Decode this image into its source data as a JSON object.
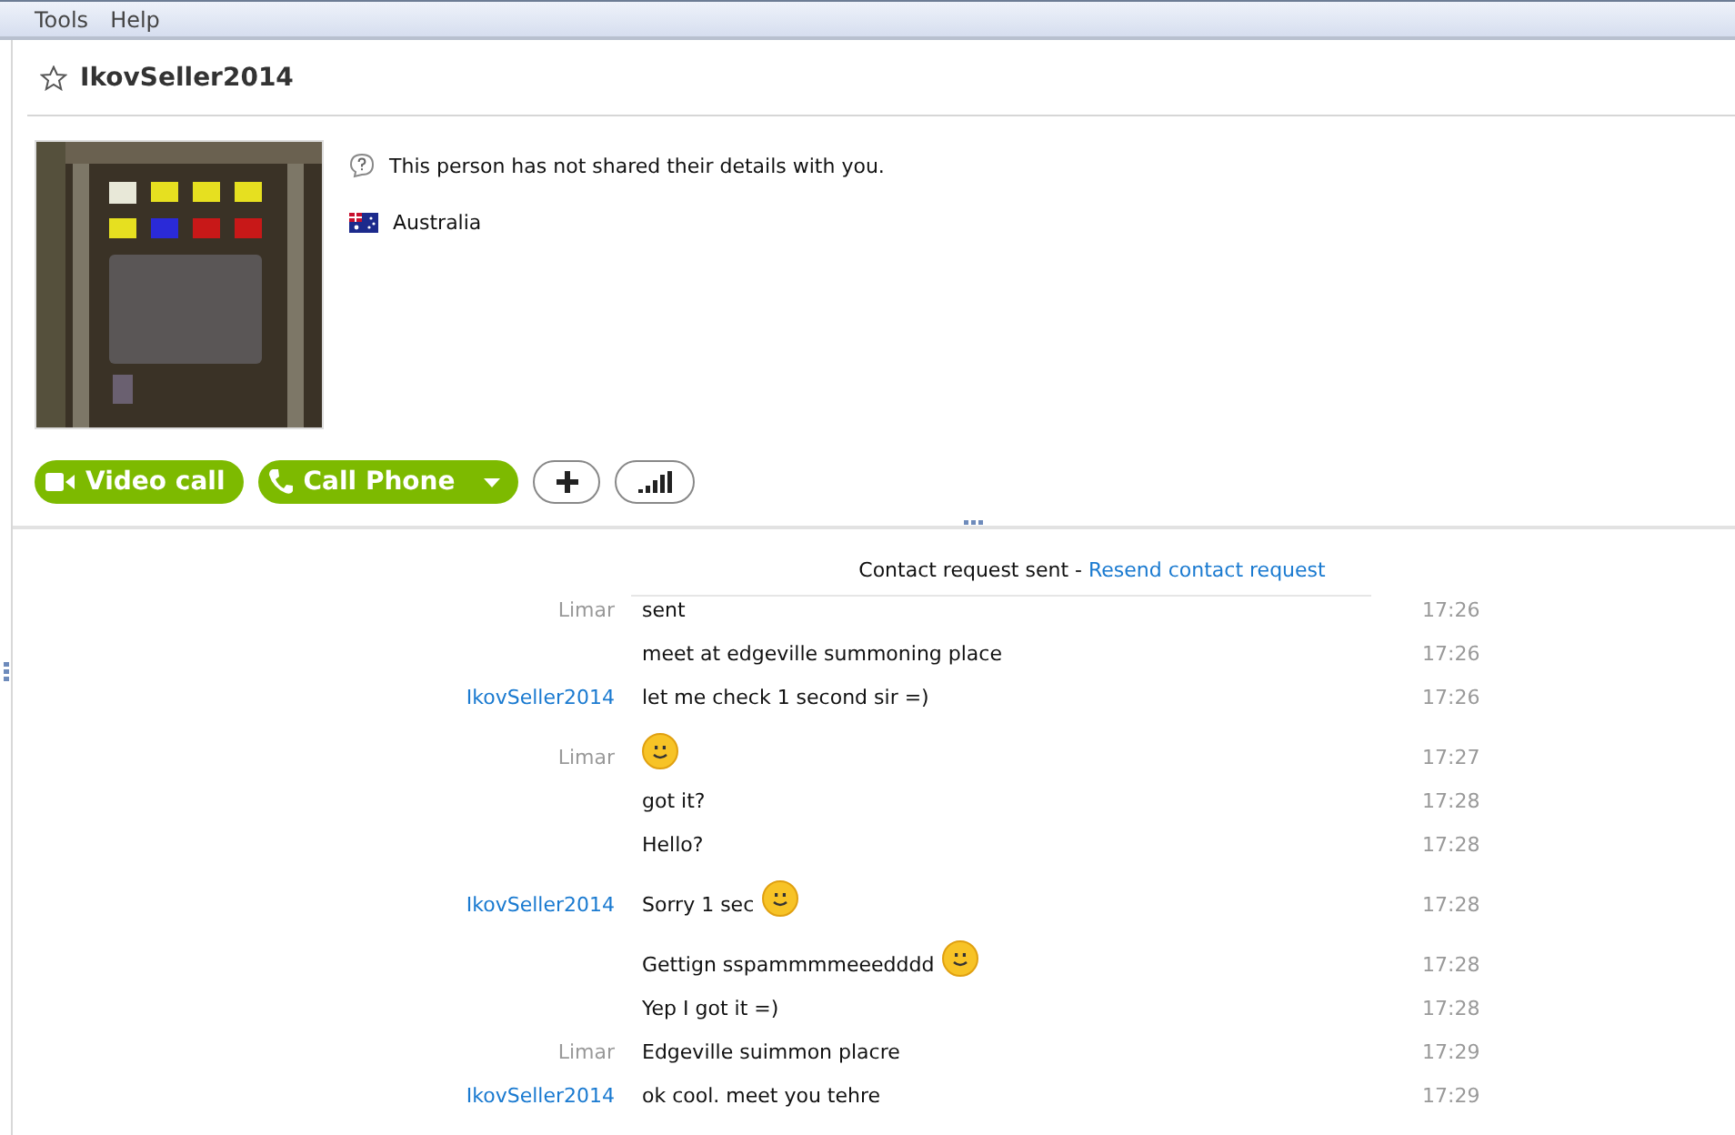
{
  "menu": [
    "Tools",
    "Help"
  ],
  "contact": {
    "name": "IkovSeller2014",
    "favorite": false,
    "details_note": "This person has not shared their details with you.",
    "country": "Australia"
  },
  "actions": [
    {
      "kind": "video",
      "label": "Video call"
    },
    {
      "kind": "phone",
      "label": "Call Phone"
    },
    {
      "kind": "add"
    },
    {
      "kind": "signal"
    }
  ],
  "request": {
    "text": "Contact request sent - ",
    "link": "Resend contact request"
  },
  "messages": [
    {
      "kind": "other",
      "sender": "Limar",
      "text": "sent",
      "time": "17:26"
    },
    {
      "text": "meet at edgeville summoning place",
      "time": "17:26"
    },
    {
      "kind": "self",
      "sender": "IkovSeller2014",
      "text": "let me check 1 second sir =)",
      "time": "17:26"
    },
    {
      "kind": "other",
      "sender": "Limar",
      "emoticon": true,
      "time": "17:27"
    },
    {
      "text": "got it?",
      "time": "17:28"
    },
    {
      "text": "Hello?",
      "time": "17:28"
    },
    {
      "kind": "self",
      "sender": "IkovSeller2014",
      "text": "Sorry 1 sec",
      "emoticon": true,
      "time": "17:28"
    },
    {
      "text": "Gettign sspammmmeeedddd",
      "emoticon": true,
      "time": "17:28"
    },
    {
      "text": "Yep I got it =)",
      "time": "17:28"
    },
    {
      "kind": "other",
      "sender": "Limar",
      "text": "Edgeville suimmon placre",
      "time": "17:29"
    },
    {
      "kind": "self",
      "sender": "IkovSeller2014",
      "text": "ok cool. meet you tehre",
      "time": "17:29"
    }
  ]
}
